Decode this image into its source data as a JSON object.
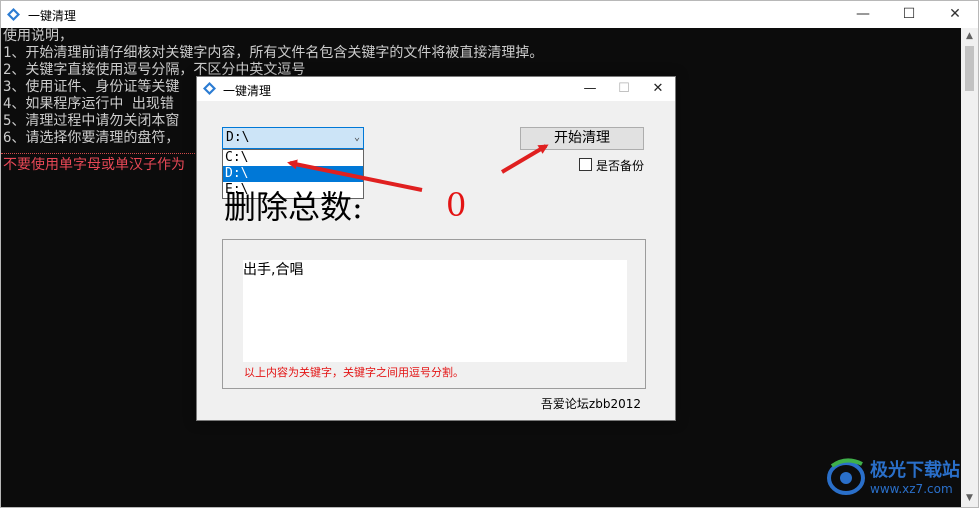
{
  "outer_window": {
    "title": "一键清理",
    "controls": {
      "minimize": "—",
      "maximize": "☐",
      "close": "✕"
    }
  },
  "console": {
    "lines": [
      "使用说明，",
      "1、开始清理前请仔细核对关键字内容，所有文件名包含关键字的文件将被直接清理掉。",
      "2、关键字直接使用逗号分隔，不区分中英文逗号",
      "3、使用证件、身份证等关键",
      "4、如果程序运行中 出现错",
      "5、清理过程中请勿关闭本窗",
      "6、请选择你要清理的盘符，"
    ],
    "warning": "不要使用单字母或单汉子作为"
  },
  "dialog": {
    "title": "一键清理",
    "controls": {
      "minimize": "—",
      "maximize": "☐",
      "close": "✕"
    },
    "drive_select": {
      "selected": "D:\\",
      "options": [
        "C:\\",
        "D:\\",
        "E:\\"
      ],
      "arrow": "⌄"
    },
    "start_button": "开始清理",
    "backup_checkbox": {
      "label": "是否备份",
      "checked": false
    },
    "total_label": "删除总数:",
    "total_count": "0",
    "keywords_text": "出手,合唱",
    "hint": "以上内容为关键字，关键字之间用逗号分割。",
    "credit": "吾爱论坛zbb2012"
  },
  "watermark": {
    "brand": "极光下载站",
    "url": "www.xz7.com"
  },
  "colors": {
    "console_bg": "#0c0c0c",
    "console_text": "#cccccc",
    "warning_text": "#e74856",
    "accent": "#0078d7",
    "count_red": "#e31414",
    "arrow_red": "#e02020"
  }
}
